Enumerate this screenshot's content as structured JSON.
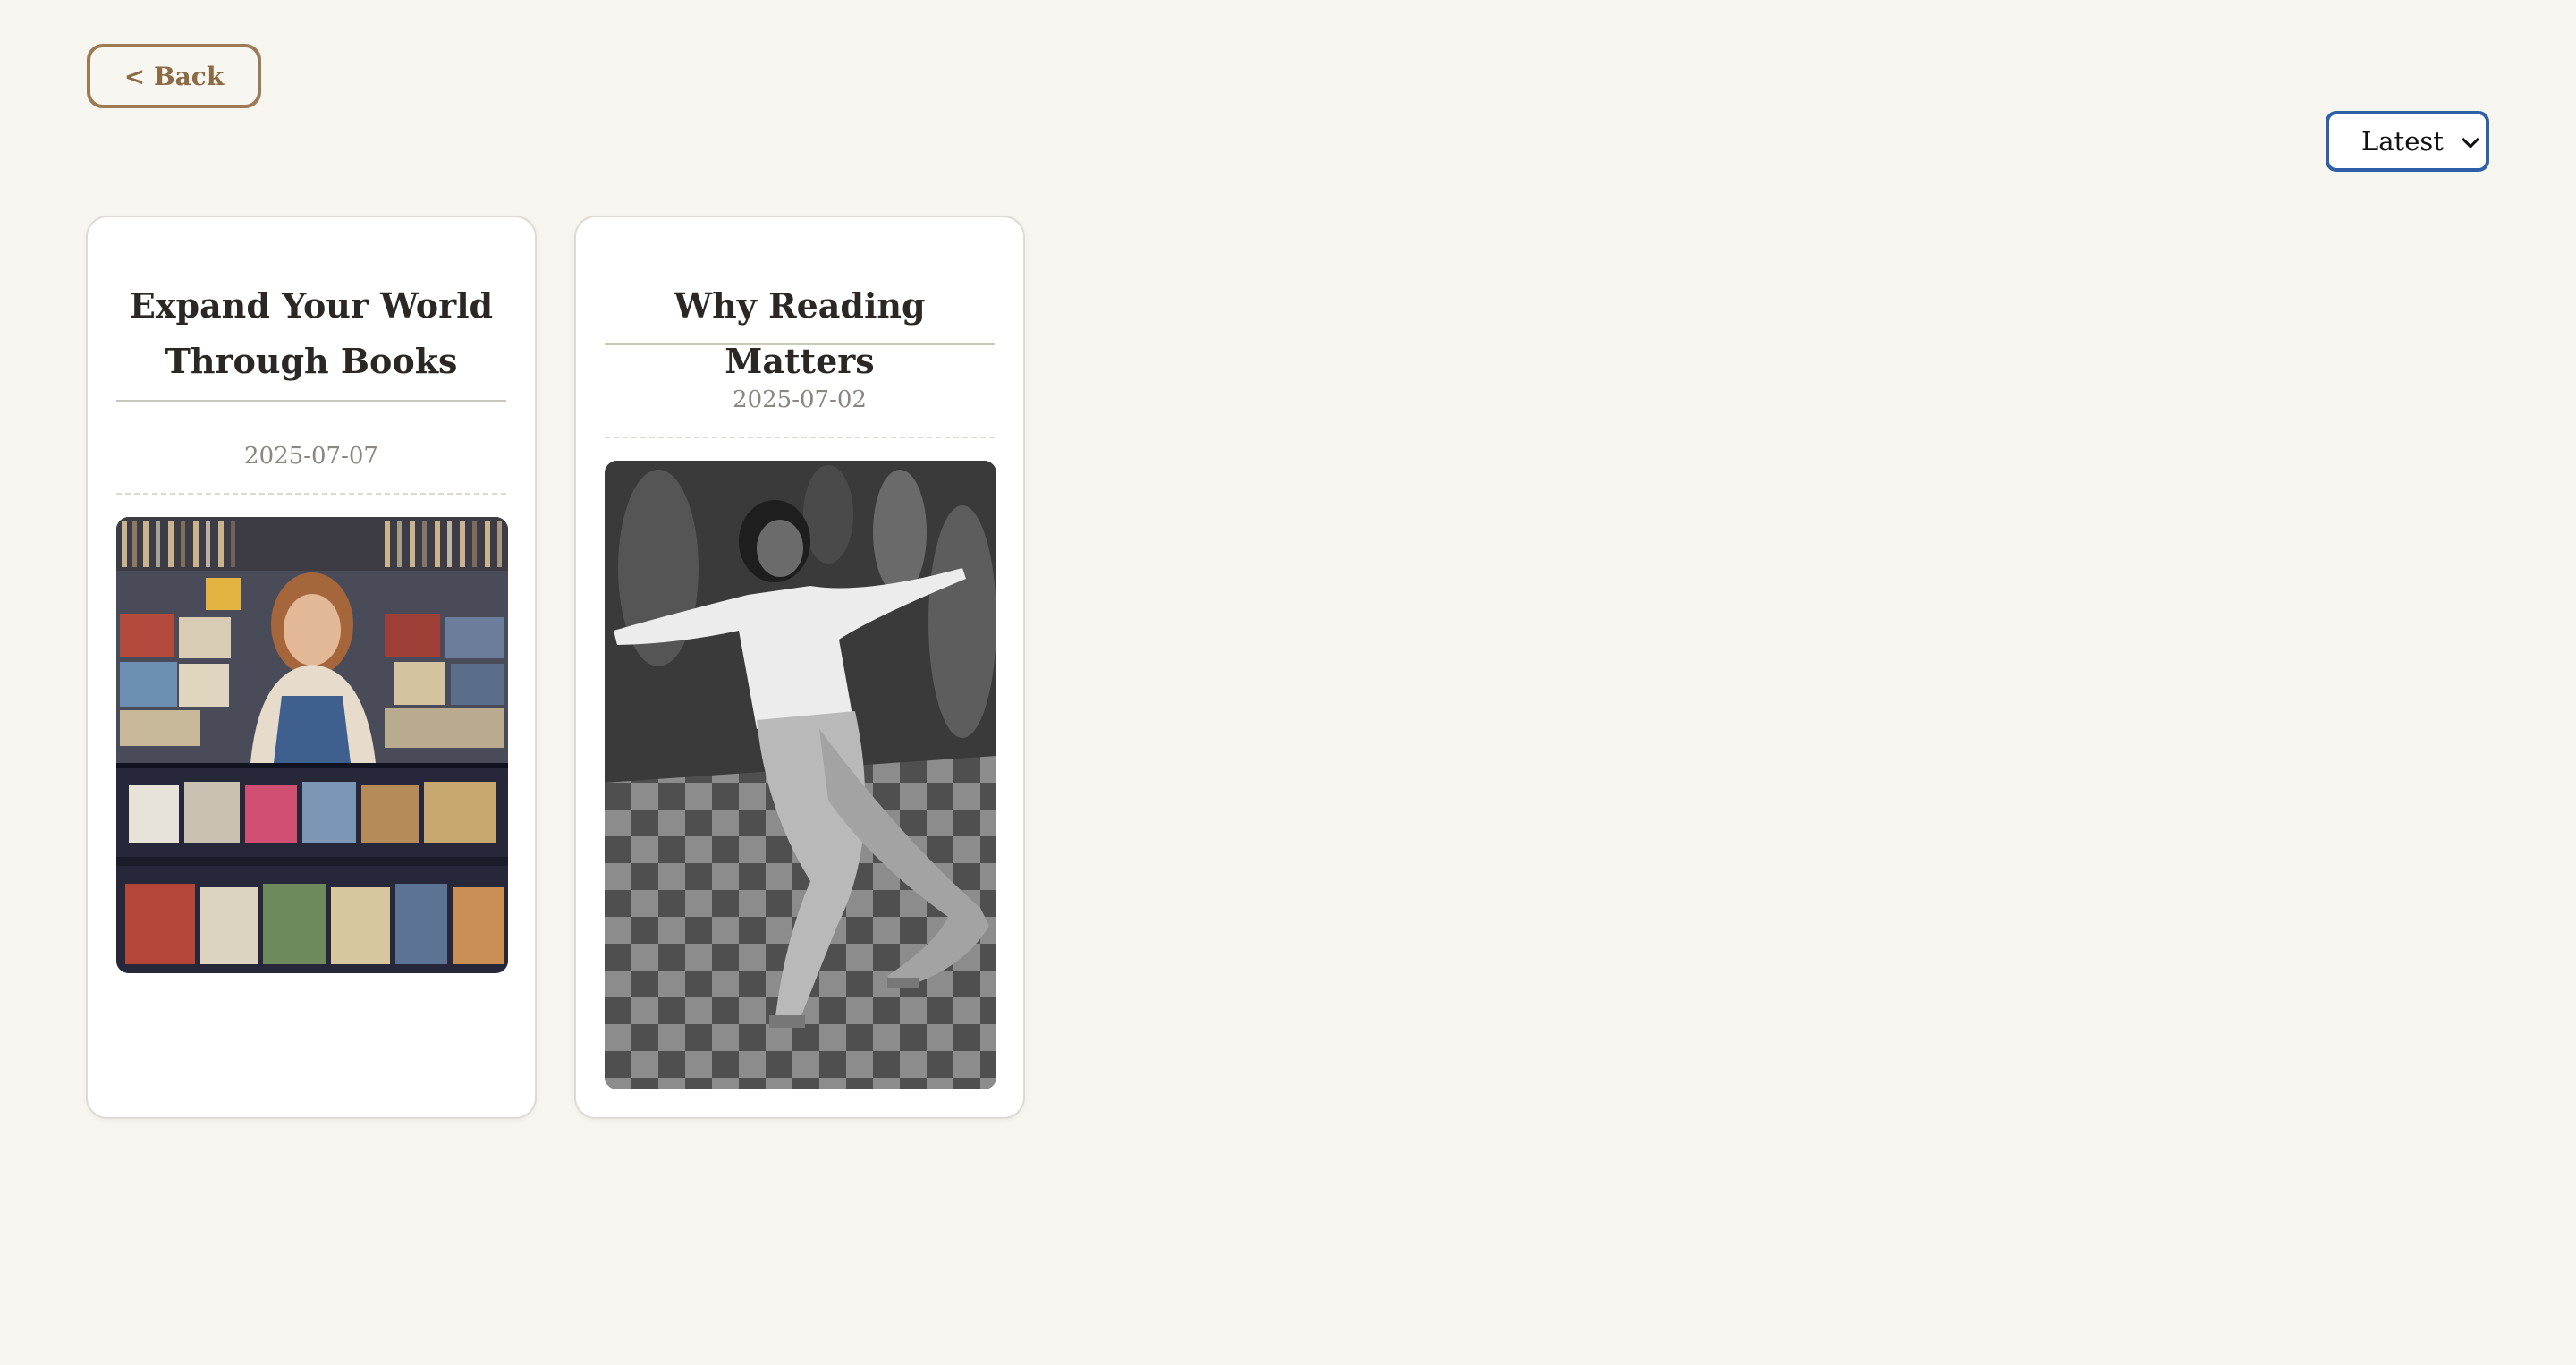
{
  "header": {
    "back_label": "< Back"
  },
  "sort": {
    "selected": "Latest"
  },
  "posts": [
    {
      "title": "Expand Your World Through Books",
      "date": "2025-07-07",
      "image": "woman-in-record-store-photo"
    },
    {
      "title": "Why Reading Matters",
      "date": "2025-07-02",
      "image": "black-and-white-dancer-photo"
    }
  ],
  "colors": {
    "page_background": "#f6f5f0",
    "back_button_border": "#9c7a53",
    "select_border": "#2f5fa6",
    "card_background": "#ffffff"
  }
}
